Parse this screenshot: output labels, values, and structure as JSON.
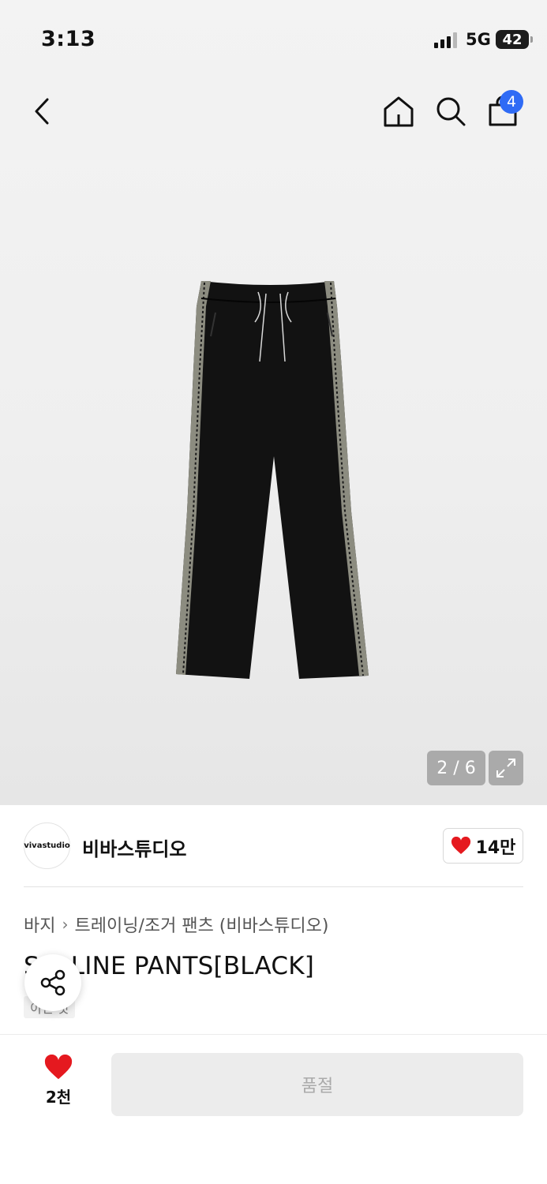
{
  "status_bar": {
    "time": "3:13",
    "network": "5G",
    "battery": "42"
  },
  "header": {
    "cart_count": "4",
    "icons": [
      "chevron-left-icon",
      "home-icon",
      "search-icon",
      "shopping-bag-icon"
    ]
  },
  "gallery": {
    "counter": "2 / 6",
    "expand_icon": "expand-icon"
  },
  "brand": {
    "logo_text": "vivastudio",
    "name": "비바스튜디오",
    "likes": "14만"
  },
  "breadcrumb": {
    "category": "바지",
    "subcategory": "트레이닝/조거 팬츠 (비바스튜디오)"
  },
  "product": {
    "title": "S   E LINE PANTS[BLACK]",
    "tag": "이런 것"
  },
  "bottom_bar": {
    "wish_count": "2천",
    "buy_label": "품절"
  },
  "colors": {
    "accent_blue": "#2f6bf5",
    "heart_red": "#e5191f",
    "disabled_gray": "#ececec"
  }
}
